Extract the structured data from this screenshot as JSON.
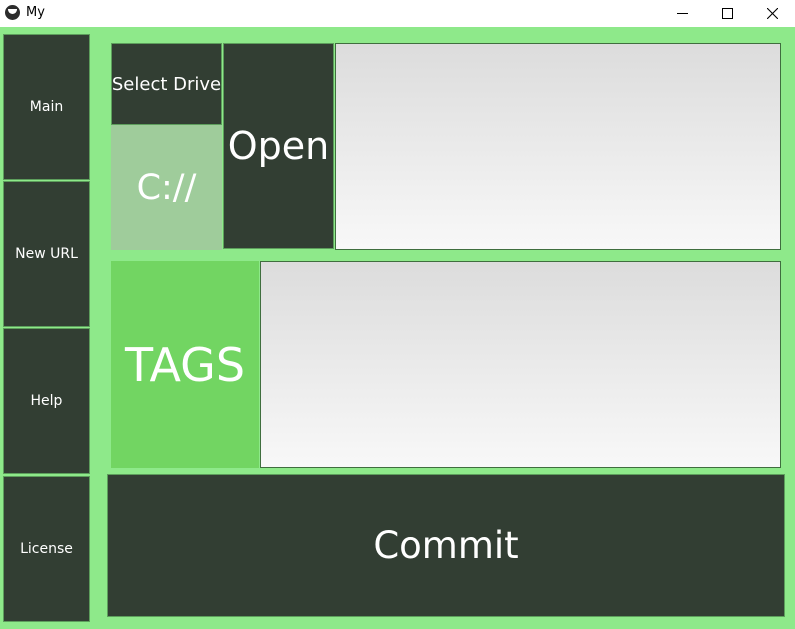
{
  "window": {
    "title": "My",
    "controls": {
      "minimize_icon": "minimize-icon",
      "maximize_icon": "maximize-icon",
      "close_icon": "close-icon"
    }
  },
  "sidebar": {
    "items": [
      {
        "label": "Main"
      },
      {
        "label": "New URL"
      },
      {
        "label": "Help"
      },
      {
        "label": "License"
      }
    ]
  },
  "drive": {
    "select_label": "Select Drive",
    "current_value": "C://",
    "open_label": "Open",
    "path_text": ""
  },
  "tags": {
    "label": "TAGS",
    "input_text": ""
  },
  "commit": {
    "label": "Commit"
  },
  "colors": {
    "background": "#8ee98a",
    "button_dark": "#323e33",
    "drive_value_bg": "#9fcc9b",
    "tags_label_bg": "#72d562",
    "text_white": "#ffffff"
  }
}
